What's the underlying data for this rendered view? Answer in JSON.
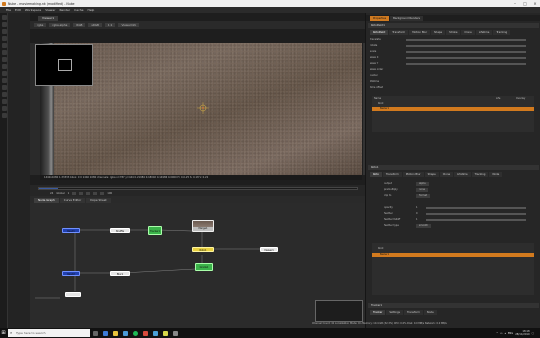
{
  "window": {
    "title": "Nuke - moviemaking.nk (modified) - Nuke"
  },
  "menu": [
    "File",
    "Edit",
    "Workspace",
    "Viewer",
    "Render",
    "Cache",
    "Help"
  ],
  "viewer": {
    "tab": "Viewer1",
    "toolbar": [
      "rgba",
      "rgba.alpha",
      "RGB",
      "sRGB",
      "1:1",
      "ViewerInfo"
    ],
    "status": "1440x1080 1.33333  bbox: 0 0 1440 1080 channels: rgba  x=787 y=444  0.21984 0.18002 0.14986 0.0000  H: 0.0-25 S: 0.18 V: 0.22"
  },
  "timeline": {
    "fps": "24",
    "controls": [
      "Global",
      "1",
      "100"
    ],
    "progress": 0.06,
    "ticks": [
      "1",
      "50",
      "100",
      "150",
      "200",
      "250",
      "300",
      "350",
      "400",
      "450"
    ]
  },
  "nodegraph": {
    "tabs": [
      "Node Graph",
      "Curve Editor",
      "Dope Sheet"
    ],
    "nodes": [
      {
        "label": "Read1"
      },
      {
        "label": "Shuffle"
      },
      {
        "label": "Tracker1"
      },
      {
        "label": "Merge1"
      },
      {
        "label": "Roto1"
      },
      {
        "label": "Viewer1"
      },
      {
        "label": "Read2"
      },
      {
        "label": "Blur1"
      },
      {
        "label": "Grade1"
      }
    ]
  },
  "properties": {
    "tabs": [
      "Properties",
      "Background Renders"
    ],
    "panel1": {
      "name": "RotoPaint1",
      "subtabs": [
        "RotoPaint",
        "Transform",
        "Motion Blur",
        "Shape",
        "Stroke",
        "Clone",
        "Lifetime",
        "Tracking",
        "Node"
      ],
      "params": [
        "translate",
        "rotate",
        "scale",
        "skew X",
        "skew Y",
        "skew order",
        "center",
        "lifetime",
        "time offset"
      ],
      "layers_header": [
        "Name",
        "Life",
        "Overlay"
      ],
      "layers": [
        "Root",
        "Bezier1"
      ]
    },
    "panel2": {
      "name": "Roto1",
      "subtabs": [
        "Roto",
        "Transform",
        "Motion Blur",
        "Shape",
        "Clone",
        "Lifetime",
        "Tracking",
        "Node"
      ],
      "params": [
        "output",
        "premultiply",
        "clip to",
        "",
        "opacity",
        "feather",
        "feather falloff",
        "feather type"
      ],
      "values": [
        "alpha",
        "none",
        "format",
        "",
        "1",
        "0",
        "1",
        "smooth"
      ],
      "layers": [
        "Root",
        "Bezier1"
      ]
    },
    "tracker": {
      "name": "Tracker1",
      "subtabs": [
        "Tracker",
        "Settings",
        "Transform",
        "Node"
      ]
    }
  },
  "statusbar": "Channel Count: 41  Localization Mode: On  Memory: 10.4 GB (32.3%)  CPU: 0.0%  Disk: 0.0 MB/s  Network: 0.0 MB/s",
  "taskbar": {
    "search_placeholder": "Type here to search",
    "clock_time": "18:18",
    "clock_date": "28/11/2019",
    "lang": "ENG"
  },
  "colors": {
    "accent": "#d27a1e",
    "node_read": "#2040b0",
    "node_green": "#3bb34a"
  }
}
